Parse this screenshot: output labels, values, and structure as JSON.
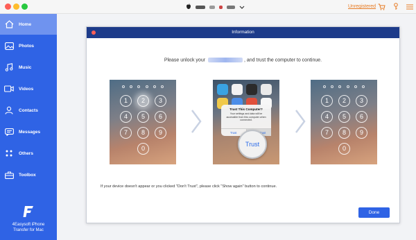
{
  "titlebar": {
    "unregistered_label": "Unregistered",
    "icons": [
      "apple-icon",
      "chevron-down-icon",
      "cart-icon",
      "key-icon",
      "menu-icon"
    ]
  },
  "sidebar": {
    "items": [
      {
        "label": "Home",
        "icon": "home-icon",
        "active": true
      },
      {
        "label": "Photos",
        "icon": "photos-icon"
      },
      {
        "label": "Music",
        "icon": "music-icon"
      },
      {
        "label": "Videos",
        "icon": "videos-icon"
      },
      {
        "label": "Contacts",
        "icon": "contacts-icon"
      },
      {
        "label": "Messages",
        "icon": "messages-icon"
      },
      {
        "label": "Others",
        "icon": "others-icon"
      },
      {
        "label": "Toolbox",
        "icon": "toolbox-icon"
      }
    ],
    "brand_line1": "4Easysoft iPhone",
    "brand_line2": "Transfer for Mac"
  },
  "dialog": {
    "title": "Information",
    "instruction_before": "Please unlock your",
    "instruction_after": ", and trust the computer to continue.",
    "trust_popup": {
      "title": "Trust This Computer?",
      "message": "Your settings and data will be accessible from this computer when connected.",
      "trust_label": "Trust",
      "dont_trust_label": "Don't Trust"
    },
    "magnifier_label": "Trust",
    "hint": "If your device doesn't appear or you clicked \"Don't Trust\", please click \"Show again\" button to continue.",
    "done_label": "Done",
    "keypad_keys": [
      "1",
      "2",
      "3",
      "4",
      "5",
      "6",
      "7",
      "8",
      "9",
      "0"
    ]
  },
  "colors": {
    "sidebar_bg": "#2f63e5",
    "sidebar_active": "#6f93ef",
    "dialog_header": "#1d3b8a",
    "accent_orange": "#e77b23",
    "done_button": "#2f63e5"
  }
}
